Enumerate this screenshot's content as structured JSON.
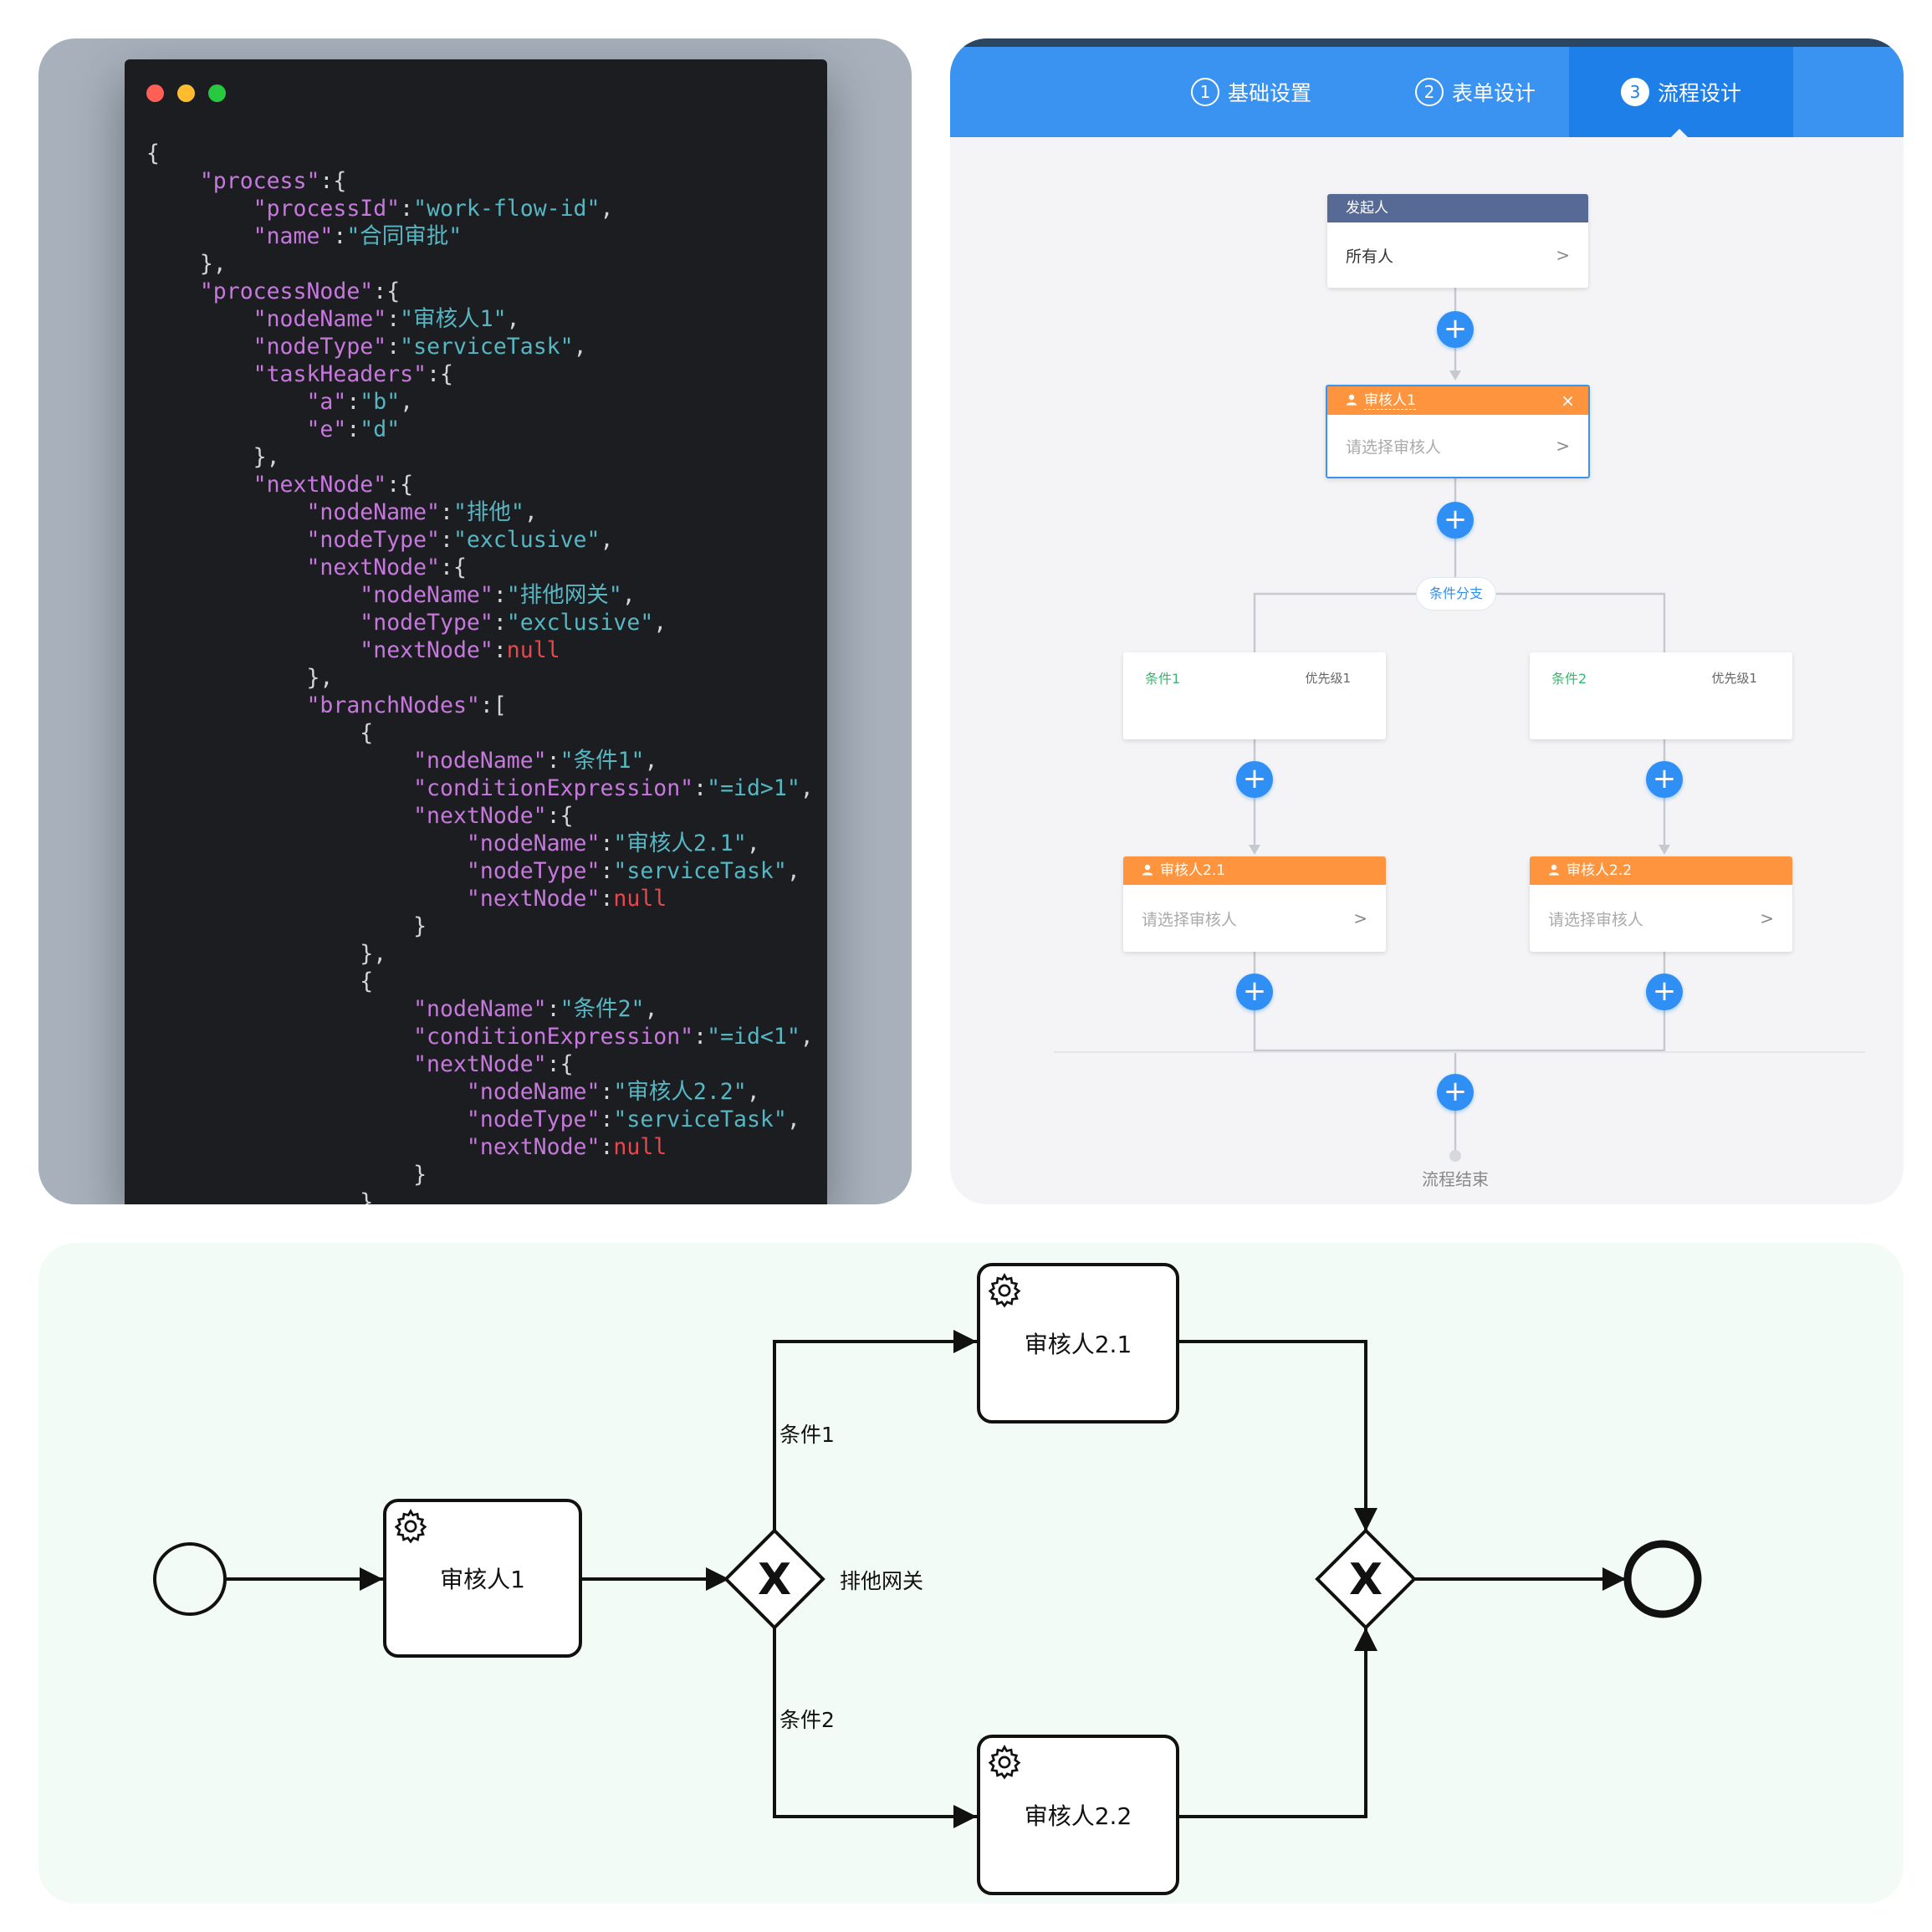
{
  "code_panel": {
    "lines": [
      [
        {
          "t": "{",
          "c": "p"
        }
      ],
      [
        {
          "t": "    ",
          "c": "p"
        },
        {
          "t": "\"process\"",
          "c": "k"
        },
        {
          "t": ":{",
          "c": "p"
        }
      ],
      [
        {
          "t": "        ",
          "c": "p"
        },
        {
          "t": "\"processId\"",
          "c": "k"
        },
        {
          "t": ":",
          "c": "p"
        },
        {
          "t": "\"work-flow-id\"",
          "c": "v"
        },
        {
          "t": ",",
          "c": "p"
        }
      ],
      [
        {
          "t": "        ",
          "c": "p"
        },
        {
          "t": "\"name\"",
          "c": "k"
        },
        {
          "t": ":",
          "c": "p"
        },
        {
          "t": "\"合同审批\"",
          "c": "v"
        }
      ],
      [
        {
          "t": "    },",
          "c": "p"
        }
      ],
      [
        {
          "t": "    ",
          "c": "p"
        },
        {
          "t": "\"processNode\"",
          "c": "k"
        },
        {
          "t": ":{",
          "c": "p"
        }
      ],
      [
        {
          "t": "        ",
          "c": "p"
        },
        {
          "t": "\"nodeName\"",
          "c": "k"
        },
        {
          "t": ":",
          "c": "p"
        },
        {
          "t": "\"审核人1\"",
          "c": "v"
        },
        {
          "t": ",",
          "c": "p"
        }
      ],
      [
        {
          "t": "        ",
          "c": "p"
        },
        {
          "t": "\"nodeType\"",
          "c": "k"
        },
        {
          "t": ":",
          "c": "p"
        },
        {
          "t": "\"serviceTask\"",
          "c": "v"
        },
        {
          "t": ",",
          "c": "p"
        }
      ],
      [
        {
          "t": "        ",
          "c": "p"
        },
        {
          "t": "\"taskHeaders\"",
          "c": "k"
        },
        {
          "t": ":{",
          "c": "p"
        }
      ],
      [
        {
          "t": "            ",
          "c": "p"
        },
        {
          "t": "\"a\"",
          "c": "k"
        },
        {
          "t": ":",
          "c": "p"
        },
        {
          "t": "\"b\"",
          "c": "v"
        },
        {
          "t": ",",
          "c": "p"
        }
      ],
      [
        {
          "t": "            ",
          "c": "p"
        },
        {
          "t": "\"e\"",
          "c": "k"
        },
        {
          "t": ":",
          "c": "p"
        },
        {
          "t": "\"d\"",
          "c": "v"
        }
      ],
      [
        {
          "t": "        },",
          "c": "p"
        }
      ],
      [
        {
          "t": "        ",
          "c": "p"
        },
        {
          "t": "\"nextNode\"",
          "c": "k"
        },
        {
          "t": ":{",
          "c": "p"
        }
      ],
      [
        {
          "t": "            ",
          "c": "p"
        },
        {
          "t": "\"nodeName\"",
          "c": "k"
        },
        {
          "t": ":",
          "c": "p"
        },
        {
          "t": "\"排他\"",
          "c": "v"
        },
        {
          "t": ",",
          "c": "p"
        }
      ],
      [
        {
          "t": "            ",
          "c": "p"
        },
        {
          "t": "\"nodeType\"",
          "c": "k"
        },
        {
          "t": ":",
          "c": "p"
        },
        {
          "t": "\"exclusive\"",
          "c": "v"
        },
        {
          "t": ",",
          "c": "p"
        }
      ],
      [
        {
          "t": "            ",
          "c": "p"
        },
        {
          "t": "\"nextNode\"",
          "c": "k"
        },
        {
          "t": ":{",
          "c": "p"
        }
      ],
      [
        {
          "t": "                ",
          "c": "p"
        },
        {
          "t": "\"nodeName\"",
          "c": "k"
        },
        {
          "t": ":",
          "c": "p"
        },
        {
          "t": "\"排他网关\"",
          "c": "v"
        },
        {
          "t": ",",
          "c": "p"
        }
      ],
      [
        {
          "t": "                ",
          "c": "p"
        },
        {
          "t": "\"nodeType\"",
          "c": "k"
        },
        {
          "t": ":",
          "c": "p"
        },
        {
          "t": "\"exclusive\"",
          "c": "v"
        },
        {
          "t": ",",
          "c": "p"
        }
      ],
      [
        {
          "t": "                ",
          "c": "p"
        },
        {
          "t": "\"nextNode\"",
          "c": "k"
        },
        {
          "t": ":",
          "c": "p"
        },
        {
          "t": "null",
          "c": "n"
        }
      ],
      [
        {
          "t": "            },",
          "c": "p"
        }
      ],
      [
        {
          "t": "            ",
          "c": "p"
        },
        {
          "t": "\"branchNodes\"",
          "c": "k"
        },
        {
          "t": ":[",
          "c": "p"
        }
      ],
      [
        {
          "t": "                {",
          "c": "p"
        }
      ],
      [
        {
          "t": "                    ",
          "c": "p"
        },
        {
          "t": "\"nodeName\"",
          "c": "k"
        },
        {
          "t": ":",
          "c": "p"
        },
        {
          "t": "\"条件1\"",
          "c": "v"
        },
        {
          "t": ",",
          "c": "p"
        }
      ],
      [
        {
          "t": "                    ",
          "c": "p"
        },
        {
          "t": "\"conditionExpression\"",
          "c": "k"
        },
        {
          "t": ":",
          "c": "p"
        },
        {
          "t": "\"=id>1\"",
          "c": "v"
        },
        {
          "t": ",",
          "c": "p"
        }
      ],
      [
        {
          "t": "                    ",
          "c": "p"
        },
        {
          "t": "\"nextNode\"",
          "c": "k"
        },
        {
          "t": ":{",
          "c": "p"
        }
      ],
      [
        {
          "t": "                        ",
          "c": "p"
        },
        {
          "t": "\"nodeName\"",
          "c": "k"
        },
        {
          "t": ":",
          "c": "p"
        },
        {
          "t": "\"审核人2.1\"",
          "c": "v"
        },
        {
          "t": ",",
          "c": "p"
        }
      ],
      [
        {
          "t": "                        ",
          "c": "p"
        },
        {
          "t": "\"nodeType\"",
          "c": "k"
        },
        {
          "t": ":",
          "c": "p"
        },
        {
          "t": "\"serviceTask\"",
          "c": "v"
        },
        {
          "t": ",",
          "c": "p"
        }
      ],
      [
        {
          "t": "                        ",
          "c": "p"
        },
        {
          "t": "\"nextNode\"",
          "c": "k"
        },
        {
          "t": ":",
          "c": "p"
        },
        {
          "t": "null",
          "c": "n"
        }
      ],
      [
        {
          "t": "                    }",
          "c": "p"
        }
      ],
      [
        {
          "t": "                },",
          "c": "p"
        }
      ],
      [
        {
          "t": "                {",
          "c": "p"
        }
      ],
      [
        {
          "t": "                    ",
          "c": "p"
        },
        {
          "t": "\"nodeName\"",
          "c": "k"
        },
        {
          "t": ":",
          "c": "p"
        },
        {
          "t": "\"条件2\"",
          "c": "v"
        },
        {
          "t": ",",
          "c": "p"
        }
      ],
      [
        {
          "t": "                    ",
          "c": "p"
        },
        {
          "t": "\"conditionExpression\"",
          "c": "k"
        },
        {
          "t": ":",
          "c": "p"
        },
        {
          "t": "\"=id<1\"",
          "c": "v"
        },
        {
          "t": ",",
          "c": "p"
        }
      ],
      [
        {
          "t": "                    ",
          "c": "p"
        },
        {
          "t": "\"nextNode\"",
          "c": "k"
        },
        {
          "t": ":{",
          "c": "p"
        }
      ],
      [
        {
          "t": "                        ",
          "c": "p"
        },
        {
          "t": "\"nodeName\"",
          "c": "k"
        },
        {
          "t": ":",
          "c": "p"
        },
        {
          "t": "\"审核人2.2\"",
          "c": "v"
        },
        {
          "t": ",",
          "c": "p"
        }
      ],
      [
        {
          "t": "                        ",
          "c": "p"
        },
        {
          "t": "\"nodeType\"",
          "c": "k"
        },
        {
          "t": ":",
          "c": "p"
        },
        {
          "t": "\"serviceTask\"",
          "c": "v"
        },
        {
          "t": ",",
          "c": "p"
        }
      ],
      [
        {
          "t": "                        ",
          "c": "p"
        },
        {
          "t": "\"nextNode\"",
          "c": "k"
        },
        {
          "t": ":",
          "c": "p"
        },
        {
          "t": "null",
          "c": "n"
        }
      ],
      [
        {
          "t": "                    }",
          "c": "p"
        }
      ],
      [
        {
          "t": "                }",
          "c": "p"
        }
      ]
    ]
  },
  "designer": {
    "steps": [
      {
        "num": "1",
        "label": "基础设置"
      },
      {
        "num": "2",
        "label": "表单设计"
      },
      {
        "num": "3",
        "label": "流程设计"
      }
    ],
    "initiator": {
      "title": "发起人",
      "value": "所有人",
      "chevron": ">"
    },
    "approver1": {
      "title": "审核人1",
      "placeholder": "请选择审核人",
      "close": "×",
      "chevron": ">"
    },
    "branch_label": "条件分支",
    "conditions": [
      {
        "name": "条件1",
        "priority": "优先级1"
      },
      {
        "name": "条件2",
        "priority": "优先级1"
      }
    ],
    "approvers_branch": [
      {
        "title": "审核人2.1",
        "placeholder": "请选择审核人",
        "chevron": ">"
      },
      {
        "title": "审核人2.2",
        "placeholder": "请选择审核人",
        "chevron": ">"
      }
    ],
    "plus": "+",
    "end_label": "流程结束",
    "colors": {
      "primary": "#3a93f1",
      "initiator_header": "#576a95",
      "approver_header": "#ff943e",
      "condition_text": "#3cb371"
    }
  },
  "bpmn": {
    "tasks": {
      "t1": "审核人1",
      "t21": "审核人2.1",
      "t22": "审核人2.2"
    },
    "gateway_label": "排他网关",
    "cond1": "条件1",
    "cond2": "条件2",
    "gateway_symbol": "X",
    "task_icon": "gear-icon"
  }
}
